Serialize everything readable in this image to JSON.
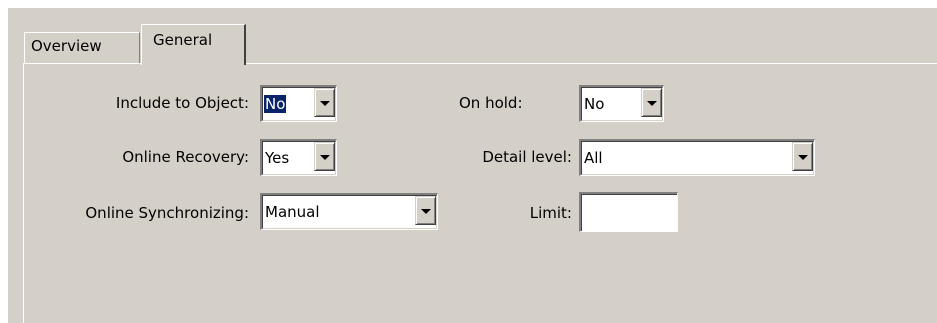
{
  "tabs": [
    {
      "label": "Overview",
      "active": false
    },
    {
      "label": "General",
      "active": true
    }
  ],
  "form": {
    "include_to_object": {
      "label": "Include to Object:",
      "value": "No"
    },
    "online_recovery": {
      "label": "Online Recovery:",
      "value": "Yes"
    },
    "online_synchronizing": {
      "label": "Online Synchronizing:",
      "value": "Manual"
    },
    "on_hold": {
      "label": "On hold:",
      "value": "No"
    },
    "detail_level": {
      "label": "Detail level:",
      "value": "All"
    },
    "limit": {
      "label": "Limit:",
      "value": ""
    }
  },
  "colors": {
    "face": "#d4d0c8",
    "highlight": "#0a246a",
    "window": "#ffffff"
  },
  "icons": {
    "dropdown": "chevron-down-icon"
  }
}
